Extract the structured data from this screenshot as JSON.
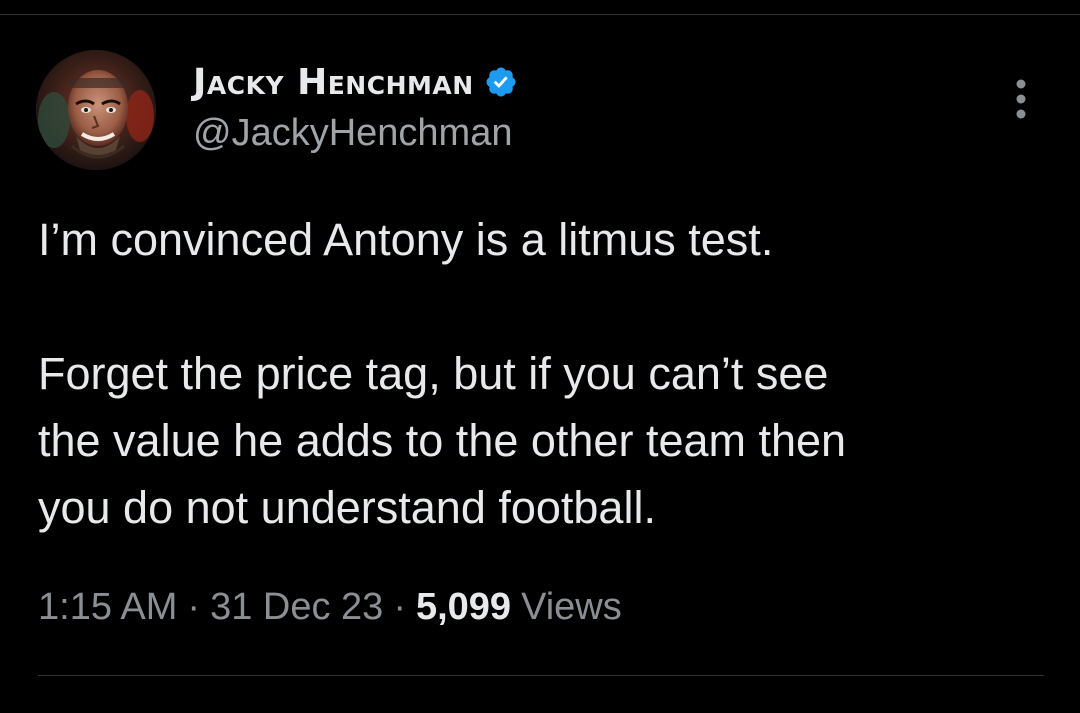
{
  "tweet": {
    "author": {
      "display_name": "Jacky Henchman",
      "handle": "@JackyHenchman",
      "verified": true,
      "avatar_icon": "profile-photo"
    },
    "more_icon": "more-options-icon",
    "text": {
      "paragraph_1": "I’m convinced Antony is a litmus test.",
      "paragraph_2": "Forget the price tag, but if you can’t see\nthe value he adds to the other team then\nyou do not understand football."
    },
    "meta": {
      "time": "1:15 AM",
      "separator": "·",
      "date": "31 Dec 23",
      "views_count": "5,099",
      "views_label": "Views"
    }
  },
  "colors": {
    "background": "#000000",
    "primary_text": "#e7e9ea",
    "secondary_text": "#8b8f94",
    "verified_blue": "#1d9bf0",
    "divider": "#2f3336"
  }
}
